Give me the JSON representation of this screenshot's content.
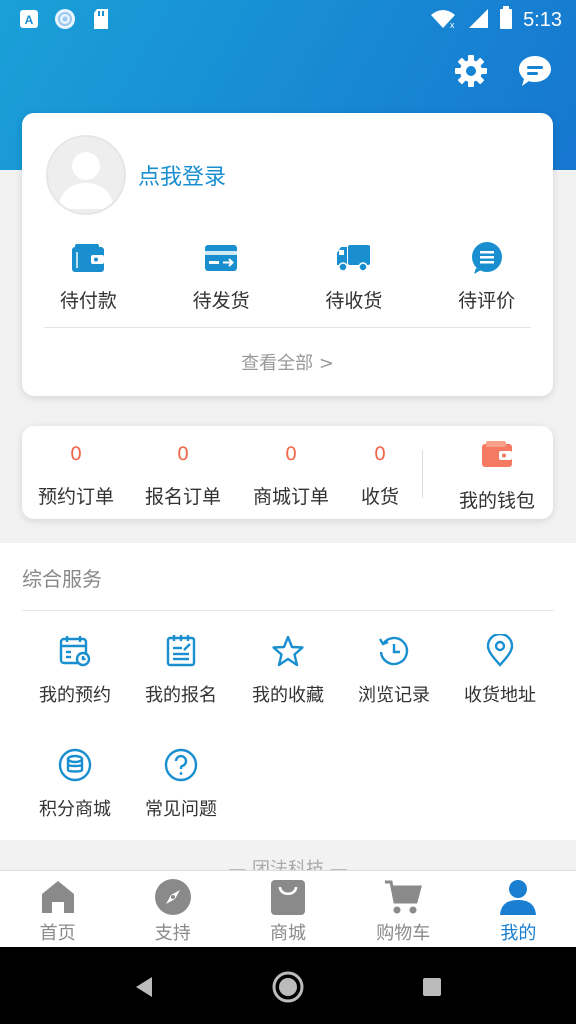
{
  "status_bar": {
    "time": "5:13",
    "icons": [
      "a-box-icon",
      "aperture-icon",
      "sd-card-icon",
      "wifi-icon",
      "signal-icon",
      "battery-icon"
    ]
  },
  "header": {
    "icons": [
      "settings-gear-icon",
      "message-bubble-icon"
    ]
  },
  "profile": {
    "login_label": "点我登录",
    "orders": [
      {
        "label": "待付款",
        "icon": "wallet-pay-icon"
      },
      {
        "label": "待发货",
        "icon": "card-send-icon"
      },
      {
        "label": "待收货",
        "icon": "truck-icon"
      },
      {
        "label": "待评价",
        "icon": "comment-list-icon"
      }
    ],
    "view_all": "查看全部 >"
  },
  "stats": {
    "items": [
      {
        "count": "0",
        "label": "预约订单"
      },
      {
        "count": "0",
        "label": "报名订单"
      },
      {
        "count": "0",
        "label": "商城订单"
      },
      {
        "count": "0",
        "label": "收货"
      }
    ],
    "wallet_label": "我的钱包"
  },
  "services": {
    "title": "综合服务",
    "items": [
      {
        "label": "我的预约",
        "icon": "calendar-clock-icon"
      },
      {
        "label": "我的报名",
        "icon": "clipboard-edit-icon"
      },
      {
        "label": "我的收藏",
        "icon": "star-icon"
      },
      {
        "label": "浏览记录",
        "icon": "history-icon"
      },
      {
        "label": "收货地址",
        "icon": "location-pin-icon"
      },
      {
        "label": "积分商城",
        "icon": "coins-icon"
      },
      {
        "label": "常见问题",
        "icon": "question-icon"
      }
    ]
  },
  "footer_brand": "— 团法科技 —",
  "tabbar": {
    "tabs": [
      {
        "label": "首页",
        "icon": "home-icon"
      },
      {
        "label": "支持",
        "icon": "compass-icon"
      },
      {
        "label": "商城",
        "icon": "shopping-bag-icon"
      },
      {
        "label": "购物车",
        "icon": "cart-icon"
      },
      {
        "label": "我的",
        "icon": "person-icon"
      }
    ],
    "active": "我的"
  },
  "colors": {
    "brand_blue": "#1a7fd0",
    "header_gradient_start": "#1aa0d8",
    "header_gradient_end": "#1677d0",
    "count_orange": "#f06a4e",
    "wallet_coral": "#f47a62"
  }
}
